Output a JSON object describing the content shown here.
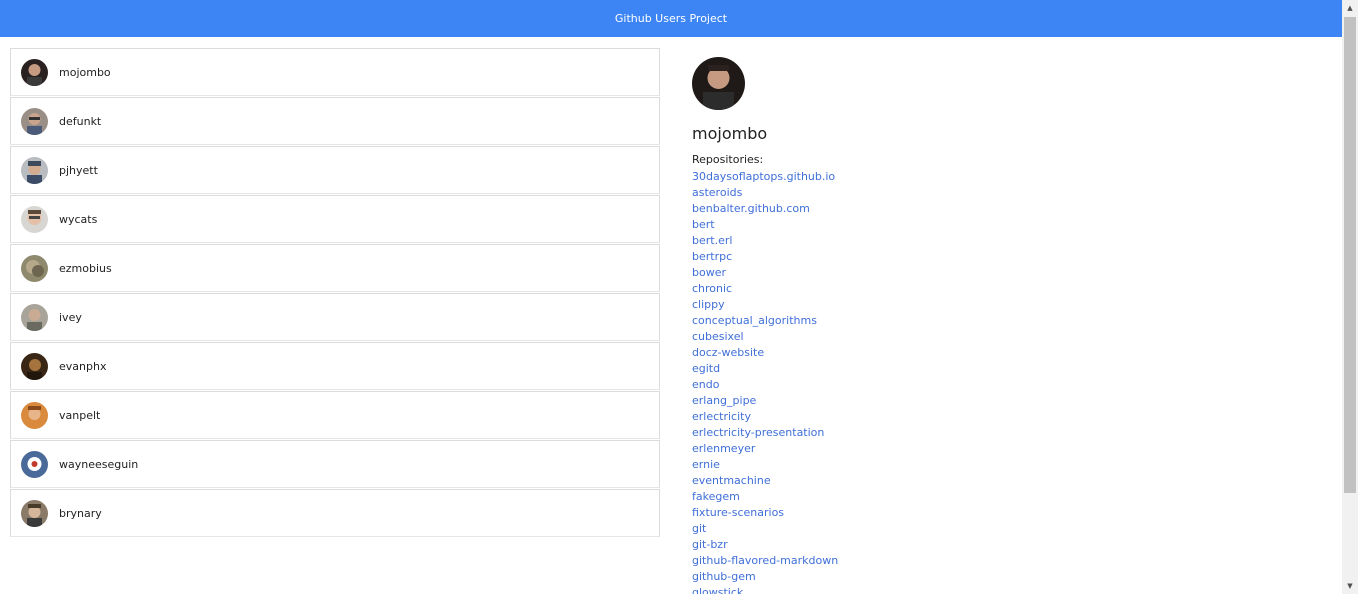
{
  "navbar": {
    "title": "Github Users Project"
  },
  "users": [
    {
      "login": "mojombo"
    },
    {
      "login": "defunkt"
    },
    {
      "login": "pjhyett"
    },
    {
      "login": "wycats"
    },
    {
      "login": "ezmobius"
    },
    {
      "login": "ivey"
    },
    {
      "login": "evanphx"
    },
    {
      "login": "vanpelt"
    },
    {
      "login": "wayneeseguin"
    },
    {
      "login": "brynary"
    }
  ],
  "selected": {
    "login": "mojombo",
    "repositories_label": "Repositories:",
    "repositories": [
      "30daysoflaptops.github.io",
      "asteroids",
      "benbalter.github.com",
      "bert",
      "bert.erl",
      "bertrpc",
      "bower",
      "chronic",
      "clippy",
      "conceptual_algorithms",
      "cubesixel",
      "docz-website",
      "egitd",
      "endo",
      "erlang_pipe",
      "erlectricity",
      "erlectricity-presentation",
      "erlenmeyer",
      "ernie",
      "eventmachine",
      "fakegem",
      "fixture-scenarios",
      "git",
      "git-bzr",
      "github-flavored-markdown",
      "github-gem",
      "glowstick"
    ]
  },
  "colors": {
    "navbar": "#3d85f4",
    "link": "#3f6fd8"
  },
  "icons": {
    "scroll_up": "scroll-up-arrow-icon",
    "scroll_down": "scroll-down-arrow-icon"
  }
}
